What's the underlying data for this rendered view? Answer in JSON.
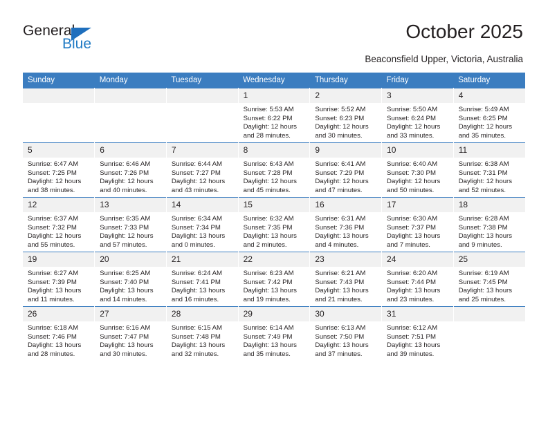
{
  "brand": {
    "name_dark": "General",
    "name_blue": "Blue",
    "triangle_icon": "blue-triangle-logo-mark",
    "accent_color": "#1f7ac4"
  },
  "header": {
    "title": "October 2025",
    "location": "Beaconsfield Upper, Victoria, Australia"
  },
  "theme": {
    "header_blue": "#3b7dc0",
    "daynum_band": "#f1f1f1",
    "text": "#231f20"
  },
  "weekday_headers": [
    "Sunday",
    "Monday",
    "Tuesday",
    "Wednesday",
    "Thursday",
    "Friday",
    "Saturday"
  ],
  "labels": {
    "sunrise_prefix": "Sunrise:",
    "sunset_prefix": "Sunset:",
    "daylight_prefix": "Daylight:"
  },
  "weeks": [
    [
      {
        "day": "",
        "empty": true
      },
      {
        "day": "",
        "empty": true
      },
      {
        "day": "",
        "empty": true
      },
      {
        "day": "1",
        "sunrise": "Sunrise: 5:53 AM",
        "sunset": "Sunset: 6:22 PM",
        "daylight1": "Daylight: 12 hours",
        "daylight2": "and 28 minutes."
      },
      {
        "day": "2",
        "sunrise": "Sunrise: 5:52 AM",
        "sunset": "Sunset: 6:23 PM",
        "daylight1": "Daylight: 12 hours",
        "daylight2": "and 30 minutes."
      },
      {
        "day": "3",
        "sunrise": "Sunrise: 5:50 AM",
        "sunset": "Sunset: 6:24 PM",
        "daylight1": "Daylight: 12 hours",
        "daylight2": "and 33 minutes."
      },
      {
        "day": "4",
        "sunrise": "Sunrise: 5:49 AM",
        "sunset": "Sunset: 6:25 PM",
        "daylight1": "Daylight: 12 hours",
        "daylight2": "and 35 minutes."
      }
    ],
    [
      {
        "day": "5",
        "sunrise": "Sunrise: 6:47 AM",
        "sunset": "Sunset: 7:25 PM",
        "daylight1": "Daylight: 12 hours",
        "daylight2": "and 38 minutes."
      },
      {
        "day": "6",
        "sunrise": "Sunrise: 6:46 AM",
        "sunset": "Sunset: 7:26 PM",
        "daylight1": "Daylight: 12 hours",
        "daylight2": "and 40 minutes."
      },
      {
        "day": "7",
        "sunrise": "Sunrise: 6:44 AM",
        "sunset": "Sunset: 7:27 PM",
        "daylight1": "Daylight: 12 hours",
        "daylight2": "and 43 minutes."
      },
      {
        "day": "8",
        "sunrise": "Sunrise: 6:43 AM",
        "sunset": "Sunset: 7:28 PM",
        "daylight1": "Daylight: 12 hours",
        "daylight2": "and 45 minutes."
      },
      {
        "day": "9",
        "sunrise": "Sunrise: 6:41 AM",
        "sunset": "Sunset: 7:29 PM",
        "daylight1": "Daylight: 12 hours",
        "daylight2": "and 47 minutes."
      },
      {
        "day": "10",
        "sunrise": "Sunrise: 6:40 AM",
        "sunset": "Sunset: 7:30 PM",
        "daylight1": "Daylight: 12 hours",
        "daylight2": "and 50 minutes."
      },
      {
        "day": "11",
        "sunrise": "Sunrise: 6:38 AM",
        "sunset": "Sunset: 7:31 PM",
        "daylight1": "Daylight: 12 hours",
        "daylight2": "and 52 minutes."
      }
    ],
    [
      {
        "day": "12",
        "sunrise": "Sunrise: 6:37 AM",
        "sunset": "Sunset: 7:32 PM",
        "daylight1": "Daylight: 12 hours",
        "daylight2": "and 55 minutes."
      },
      {
        "day": "13",
        "sunrise": "Sunrise: 6:35 AM",
        "sunset": "Sunset: 7:33 PM",
        "daylight1": "Daylight: 12 hours",
        "daylight2": "and 57 minutes."
      },
      {
        "day": "14",
        "sunrise": "Sunrise: 6:34 AM",
        "sunset": "Sunset: 7:34 PM",
        "daylight1": "Daylight: 13 hours",
        "daylight2": "and 0 minutes."
      },
      {
        "day": "15",
        "sunrise": "Sunrise: 6:32 AM",
        "sunset": "Sunset: 7:35 PM",
        "daylight1": "Daylight: 13 hours",
        "daylight2": "and 2 minutes."
      },
      {
        "day": "16",
        "sunrise": "Sunrise: 6:31 AM",
        "sunset": "Sunset: 7:36 PM",
        "daylight1": "Daylight: 13 hours",
        "daylight2": "and 4 minutes."
      },
      {
        "day": "17",
        "sunrise": "Sunrise: 6:30 AM",
        "sunset": "Sunset: 7:37 PM",
        "daylight1": "Daylight: 13 hours",
        "daylight2": "and 7 minutes."
      },
      {
        "day": "18",
        "sunrise": "Sunrise: 6:28 AM",
        "sunset": "Sunset: 7:38 PM",
        "daylight1": "Daylight: 13 hours",
        "daylight2": "and 9 minutes."
      }
    ],
    [
      {
        "day": "19",
        "sunrise": "Sunrise: 6:27 AM",
        "sunset": "Sunset: 7:39 PM",
        "daylight1": "Daylight: 13 hours",
        "daylight2": "and 11 minutes."
      },
      {
        "day": "20",
        "sunrise": "Sunrise: 6:25 AM",
        "sunset": "Sunset: 7:40 PM",
        "daylight1": "Daylight: 13 hours",
        "daylight2": "and 14 minutes."
      },
      {
        "day": "21",
        "sunrise": "Sunrise: 6:24 AM",
        "sunset": "Sunset: 7:41 PM",
        "daylight1": "Daylight: 13 hours",
        "daylight2": "and 16 minutes."
      },
      {
        "day": "22",
        "sunrise": "Sunrise: 6:23 AM",
        "sunset": "Sunset: 7:42 PM",
        "daylight1": "Daylight: 13 hours",
        "daylight2": "and 19 minutes."
      },
      {
        "day": "23",
        "sunrise": "Sunrise: 6:21 AM",
        "sunset": "Sunset: 7:43 PM",
        "daylight1": "Daylight: 13 hours",
        "daylight2": "and 21 minutes."
      },
      {
        "day": "24",
        "sunrise": "Sunrise: 6:20 AM",
        "sunset": "Sunset: 7:44 PM",
        "daylight1": "Daylight: 13 hours",
        "daylight2": "and 23 minutes."
      },
      {
        "day": "25",
        "sunrise": "Sunrise: 6:19 AM",
        "sunset": "Sunset: 7:45 PM",
        "daylight1": "Daylight: 13 hours",
        "daylight2": "and 25 minutes."
      }
    ],
    [
      {
        "day": "26",
        "sunrise": "Sunrise: 6:18 AM",
        "sunset": "Sunset: 7:46 PM",
        "daylight1": "Daylight: 13 hours",
        "daylight2": "and 28 minutes."
      },
      {
        "day": "27",
        "sunrise": "Sunrise: 6:16 AM",
        "sunset": "Sunset: 7:47 PM",
        "daylight1": "Daylight: 13 hours",
        "daylight2": "and 30 minutes."
      },
      {
        "day": "28",
        "sunrise": "Sunrise: 6:15 AM",
        "sunset": "Sunset: 7:48 PM",
        "daylight1": "Daylight: 13 hours",
        "daylight2": "and 32 minutes."
      },
      {
        "day": "29",
        "sunrise": "Sunrise: 6:14 AM",
        "sunset": "Sunset: 7:49 PM",
        "daylight1": "Daylight: 13 hours",
        "daylight2": "and 35 minutes."
      },
      {
        "day": "30",
        "sunrise": "Sunrise: 6:13 AM",
        "sunset": "Sunset: 7:50 PM",
        "daylight1": "Daylight: 13 hours",
        "daylight2": "and 37 minutes."
      },
      {
        "day": "31",
        "sunrise": "Sunrise: 6:12 AM",
        "sunset": "Sunset: 7:51 PM",
        "daylight1": "Daylight: 13 hours",
        "daylight2": "and 39 minutes."
      },
      {
        "day": "",
        "empty": true
      }
    ]
  ]
}
